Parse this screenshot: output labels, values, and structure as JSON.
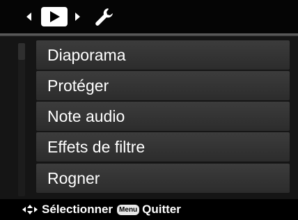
{
  "top_bar": {
    "icons": [
      "arrow-left-icon",
      "playback-icon",
      "arrow-right-icon",
      "wrench-icon"
    ],
    "selected_tab": "playback"
  },
  "menu": {
    "items": [
      {
        "label": "Diaporama"
      },
      {
        "label": "Protéger"
      },
      {
        "label": "Note audio"
      },
      {
        "label": "Effets de filtre"
      },
      {
        "label": "Rogner"
      }
    ]
  },
  "bottom_bar": {
    "navigate_icon": "dpad-icon",
    "select_label": "Sélectionner",
    "menu_key": "Menu",
    "quit_label": "Quitter"
  },
  "colors": {
    "background": "#000000",
    "item_background": "#333333",
    "text": "#ffffff"
  }
}
